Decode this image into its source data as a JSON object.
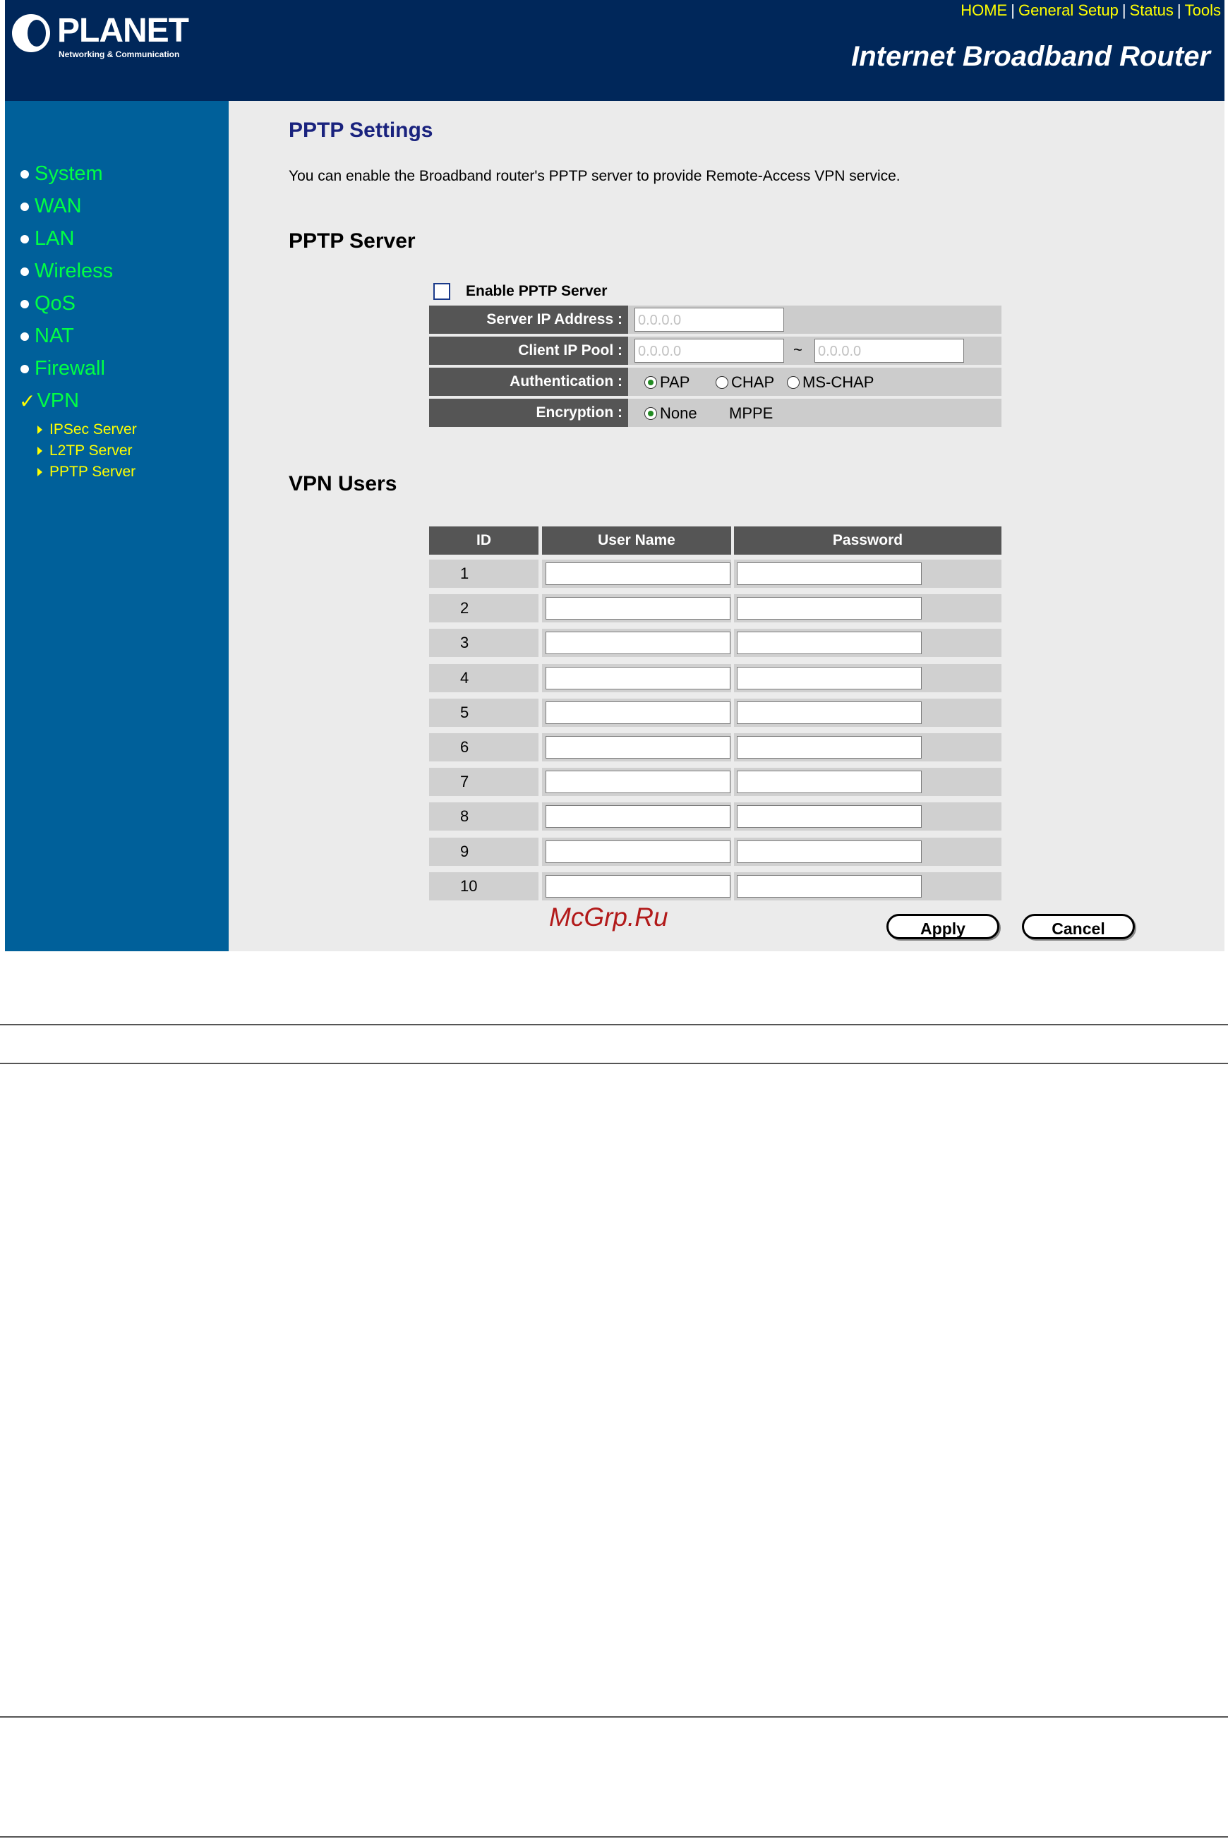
{
  "header": {
    "logo_text": "PLANET",
    "logo_tagline": "Networking & Communication",
    "links": [
      "HOME",
      "General Setup",
      "Status",
      "Tools"
    ],
    "product_title": "Internet Broadband Router"
  },
  "sidebar": {
    "items": [
      {
        "label": "System"
      },
      {
        "label": "WAN"
      },
      {
        "label": "LAN"
      },
      {
        "label": "Wireless"
      },
      {
        "label": "QoS"
      },
      {
        "label": "NAT"
      },
      {
        "label": "Firewall"
      },
      {
        "label": "VPN"
      }
    ],
    "sub_items": [
      {
        "label": "IPSec Server"
      },
      {
        "label": "L2TP Server"
      },
      {
        "label": "PPTP Server"
      }
    ]
  },
  "main": {
    "title": "PPTP Settings",
    "description": "You can enable the Broadband router's PPTP server to provide Remote-Access VPN service.",
    "server_section": "PPTP Server",
    "enable_label": "Enable PPTP Server",
    "enable_checked": false,
    "server_ip_label": "Server IP Address :",
    "server_ip_value": "0.0.0.0",
    "client_pool_label": "Client IP Pool :",
    "client_pool_start": "0.0.0.0",
    "client_pool_sep": "~",
    "client_pool_end": "0.0.0.0",
    "auth_label": "Authentication :",
    "auth_options": [
      "PAP",
      "CHAP",
      "MS-CHAP"
    ],
    "auth_selected": "PAP",
    "enc_label": "Encryption :",
    "enc_options": [
      "None",
      "MPPE"
    ],
    "enc_selected": "None",
    "users_section": "VPN Users",
    "users_headers": [
      "ID",
      "User Name",
      "Password"
    ],
    "users": [
      {
        "id": "1",
        "username": "",
        "password": ""
      },
      {
        "id": "2",
        "username": "",
        "password": ""
      },
      {
        "id": "3",
        "username": "",
        "password": ""
      },
      {
        "id": "4",
        "username": "",
        "password": ""
      },
      {
        "id": "5",
        "username": "",
        "password": ""
      },
      {
        "id": "6",
        "username": "",
        "password": ""
      },
      {
        "id": "7",
        "username": "",
        "password": ""
      },
      {
        "id": "8",
        "username": "",
        "password": ""
      },
      {
        "id": "9",
        "username": "",
        "password": ""
      },
      {
        "id": "10",
        "username": "",
        "password": ""
      }
    ],
    "apply_label": "Apply",
    "cancel_label": "Cancel",
    "watermark": "McGrp.Ru"
  },
  "colors": {
    "header_bg": "#00275a",
    "sidebar_bg": "#00609a",
    "nav_green": "#00ff44",
    "nav_yellow": "#ffff00",
    "main_bg": "#ebebeb",
    "label_cell_bg": "#555555",
    "watermark_red": "#b21a1a"
  }
}
